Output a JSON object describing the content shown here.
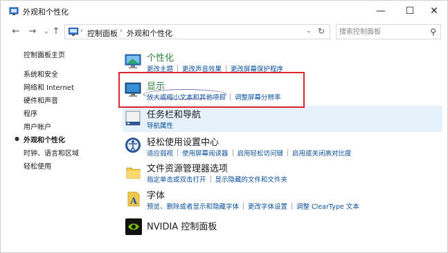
{
  "window": {
    "title": "外观和个性化",
    "controls": {
      "minimize": "—",
      "maximize": "☐",
      "close": "✕"
    }
  },
  "nav": {
    "back": "←",
    "forward": "→",
    "recent": "⌄",
    "up": "↑",
    "breadcrumbs": [
      "控制面板",
      "外观和个性化"
    ],
    "refresh": "↻",
    "search_placeholder": "搜索控制面板"
  },
  "sidebar": {
    "items": [
      {
        "label": "控制面板主页",
        "current": false
      },
      {
        "label": "系统和安全",
        "current": false
      },
      {
        "label": "网络和 Internet",
        "current": false
      },
      {
        "label": "硬件和声音",
        "current": false
      },
      {
        "label": "程序",
        "current": false
      },
      {
        "label": "用户帐户",
        "current": false
      },
      {
        "label": "外观和个性化",
        "current": true
      },
      {
        "label": "时钟、语言和区域",
        "current": false
      },
      {
        "label": "轻松使用",
        "current": false
      }
    ]
  },
  "categories": [
    {
      "title": "个性化",
      "icon": "personalization-icon",
      "links": [
        "更改主题",
        "更改声音效果",
        "更改屏幕保护程序"
      ]
    },
    {
      "title": "显示",
      "icon": "display-icon",
      "links": [
        "放大或缩小文本和其他项目",
        "调整屏幕分辨率"
      ]
    },
    {
      "title": "任务栏和导航",
      "icon": "taskbar-icon",
      "links": [
        "导航属性"
      ]
    },
    {
      "title": "轻松使用设置中心",
      "icon": "ease-of-access-icon",
      "links": [
        "适应弱视",
        "使用屏幕阅读器",
        "启用轻松访问键",
        "启用或关闭高对比度"
      ]
    },
    {
      "title": "文件资源管理器选项",
      "icon": "folder-options-icon",
      "links": [
        "指定单击或双击打开",
        "显示隐藏的文件和文件夹"
      ]
    },
    {
      "title": "字体",
      "icon": "fonts-icon",
      "links": [
        "预览、删除或者显示和隐藏字体",
        "更改字体设置",
        "调整 ClearType 文本"
      ]
    },
    {
      "title": "NVIDIA 控制面板",
      "icon": "nvidia-icon",
      "links": []
    }
  ],
  "colors": {
    "link": "#0a4f9e",
    "highlight_row": "#e5f1fb",
    "annotation_red": "#e0262b"
  }
}
